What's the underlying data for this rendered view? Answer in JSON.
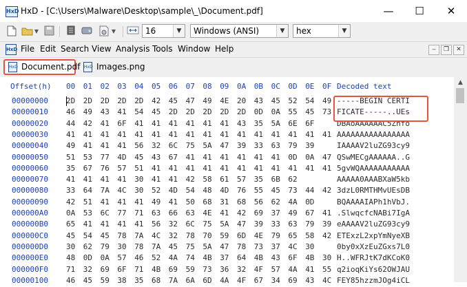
{
  "window": {
    "title": "HxD - [C:\\Users\\Malware\\Desktop\\sample\\_\\Document.pdf]",
    "app_icon_text": "HxD",
    "controls": {
      "minimize": "—",
      "maximize": "☐",
      "close": "✕"
    }
  },
  "toolbar": {
    "bytes_per_row": "16",
    "charset": "Windows (ANSI)",
    "offset_base": "hex",
    "icons": [
      "new-file-icon",
      "open-folder-icon",
      "save-icon",
      "ram-icon",
      "disk-icon",
      "disk-image-icon",
      "bytes-per-row-icon"
    ]
  },
  "menubar": {
    "items": [
      "File",
      "Edit",
      "Search",
      "View",
      "Analysis",
      "Tools",
      "Window",
      "Help"
    ],
    "mdi_controls": [
      "‒",
      "❐",
      "✕"
    ]
  },
  "tabs": [
    {
      "label": "Document.pdf",
      "active": true
    },
    {
      "label": "Images.png",
      "active": false
    }
  ],
  "editor": {
    "offset_header": "Offset(h)",
    "column_headers": [
      "00",
      "01",
      "02",
      "03",
      "04",
      "05",
      "06",
      "07",
      "08",
      "09",
      "0A",
      "0B",
      "0C",
      "0D",
      "0E",
      "0F"
    ],
    "decoded_header": "Decoded text",
    "rows": [
      {
        "offset": "00000000",
        "bytes": [
          "2D",
          "2D",
          "2D",
          "2D",
          "2D",
          "42",
          "45",
          "47",
          "49",
          "4E",
          "20",
          "43",
          "45",
          "52",
          "54",
          "49"
        ],
        "decoded": "-----BEGIN CERTI"
      },
      {
        "offset": "00000010",
        "bytes": [
          "46",
          "49",
          "43",
          "41",
          "54",
          "45",
          "2D",
          "2D",
          "2D",
          "2D",
          "2D",
          "0D",
          "0A",
          "55",
          "45",
          "73"
        ],
        "decoded": "FICATE-----..UEs"
      },
      {
        "offset": "00000020",
        "bytes": [
          "44",
          "42",
          "41",
          "6F",
          "41",
          "41",
          "41",
          "41",
          "41",
          "41",
          "43",
          "35",
          "5A",
          "6E",
          "6F"
        ],
        "decoded": "DBAoAAAAAAC5Znfo"
      },
      {
        "offset": "00000030",
        "bytes": [
          "41",
          "41",
          "41",
          "41",
          "41",
          "41",
          "41",
          "41",
          "41",
          "41",
          "41",
          "41",
          "41",
          "41",
          "41",
          "41"
        ],
        "decoded": "AAAAAAAAAAAAAAAA"
      },
      {
        "offset": "00000040",
        "bytes": [
          "49",
          "41",
          "41",
          "41",
          "56",
          "32",
          "6C",
          "75",
          "5A",
          "47",
          "39",
          "33",
          "63",
          "79",
          "39"
        ],
        "decoded": "IAAAAV2luZG93cy9"
      },
      {
        "offset": "00000050",
        "bytes": [
          "51",
          "53",
          "77",
          "4D",
          "45",
          "43",
          "67",
          "41",
          "41",
          "41",
          "41",
          "41",
          "41",
          "0D",
          "0A",
          "47"
        ],
        "decoded": "QSwMECgAAAAAA..G"
      },
      {
        "offset": "00000060",
        "bytes": [
          "35",
          "67",
          "76",
          "57",
          "51",
          "41",
          "41",
          "41",
          "41",
          "41",
          "41",
          "41",
          "41",
          "41",
          "41",
          "41"
        ],
        "decoded": "5gvWQAAAAAAAAAAA"
      },
      {
        "offset": "00000070",
        "bytes": [
          "41",
          "41",
          "41",
          "41",
          "30",
          "41",
          "41",
          "42",
          "58",
          "61",
          "57",
          "35",
          "6B",
          "62"
        ],
        "decoded": "AAAAA0AAABXaW5kb"
      },
      {
        "offset": "00000080",
        "bytes": [
          "33",
          "64",
          "7A",
          "4C",
          "30",
          "52",
          "4D",
          "54",
          "48",
          "4D",
          "76",
          "55",
          "45",
          "73",
          "44",
          "42"
        ],
        "decoded": "3dzL0RMTHMvUEsDB"
      },
      {
        "offset": "00000090",
        "bytes": [
          "42",
          "51",
          "41",
          "41",
          "41",
          "49",
          "41",
          "50",
          "68",
          "31",
          "68",
          "56",
          "62",
          "4A",
          "0D"
        ],
        "decoded": "BQAAAAIAPh1hVbJ."
      },
      {
        "offset": "000000A0",
        "bytes": [
          "0A",
          "53",
          "6C",
          "77",
          "71",
          "63",
          "66",
          "63",
          "4E",
          "41",
          "42",
          "69",
          "37",
          "49",
          "67",
          "41"
        ],
        "decoded": ".SlwqcfcNABi7IgA"
      },
      {
        "offset": "000000B0",
        "bytes": [
          "65",
          "41",
          "41",
          "41",
          "41",
          "56",
          "32",
          "6C",
          "75",
          "5A",
          "47",
          "39",
          "33",
          "63",
          "79",
          "39"
        ],
        "decoded": "eAAAAV2luZG93cy9"
      },
      {
        "offset": "000000C0",
        "bytes": [
          "45",
          "54",
          "45",
          "78",
          "7A",
          "4C",
          "32",
          "78",
          "70",
          "59",
          "6D",
          "4E",
          "79",
          "65",
          "58",
          "42"
        ],
        "decoded": "ETExzL2xpYmNyeXB"
      },
      {
        "offset": "000000D0",
        "bytes": [
          "30",
          "62",
          "79",
          "30",
          "78",
          "7A",
          "45",
          "75",
          "5A",
          "47",
          "78",
          "73",
          "37",
          "4C",
          "30"
        ],
        "decoded": "0by0xXzEuZGxs7L0"
      },
      {
        "offset": "000000E0",
        "bytes": [
          "48",
          "0D",
          "0A",
          "57",
          "46",
          "52",
          "4A",
          "74",
          "4B",
          "37",
          "64",
          "4B",
          "43",
          "6F",
          "4B",
          "30"
        ],
        "decoded": "H..WFRJtK7dKCoK0"
      },
      {
        "offset": "000000F0",
        "bytes": [
          "71",
          "32",
          "69",
          "6F",
          "71",
          "4B",
          "69",
          "59",
          "73",
          "36",
          "32",
          "4F",
          "57",
          "4A",
          "41",
          "55"
        ],
        "decoded": "q2ioqKiYs62OWJAU"
      },
      {
        "offset": "00000100",
        "bytes": [
          "46",
          "45",
          "59",
          "38",
          "35",
          "68",
          "7A",
          "6A",
          "6D",
          "4A",
          "4F",
          "67",
          "34",
          "69",
          "43",
          "4C"
        ],
        "decoded": "FEY85hzzmJOg4iCL"
      }
    ]
  },
  "colors": {
    "offset_blue": "#1d3fb8",
    "highlight_red": "#e8513b"
  }
}
